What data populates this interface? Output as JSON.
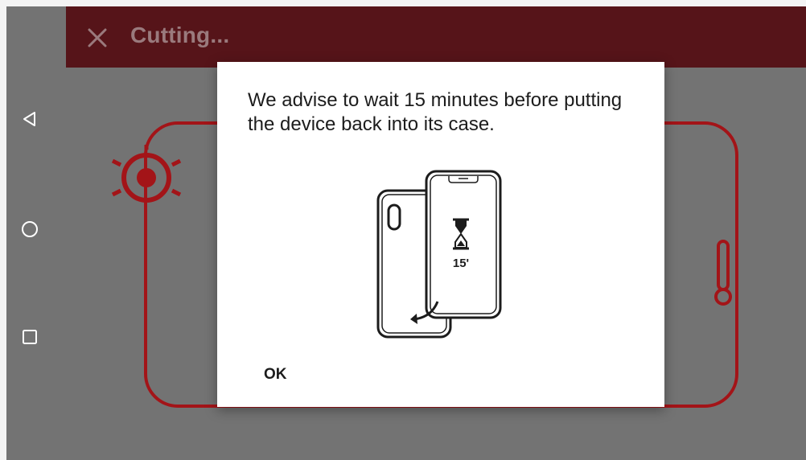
{
  "app_bar": {
    "title": "Cutting...",
    "close_icon": "close-icon",
    "background_color": "#561419"
  },
  "navigation_bar": {
    "back_icon": "triangle-back-icon",
    "home_icon": "circle-home-icon",
    "recent_apps_icon": "square-recents-icon"
  },
  "dialog": {
    "message": "We advise to wait 15 minutes before putting the device back into its case.",
    "illustration": {
      "icon": "phone-into-case-icon",
      "timer_label": "15'"
    },
    "ok_label": "OK"
  },
  "colors": {
    "accent": "#a31418",
    "overlay": "#737373",
    "dialog_background": "#ffffff"
  }
}
